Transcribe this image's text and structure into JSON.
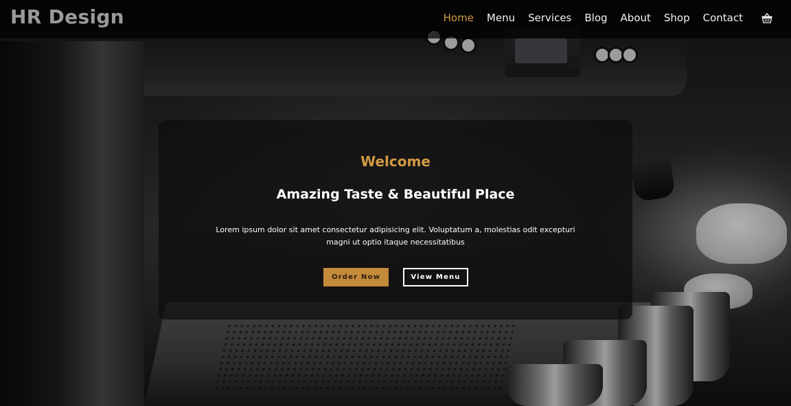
{
  "brand": {
    "name": "HR Design"
  },
  "nav": {
    "items": [
      {
        "label": "Home",
        "active": true
      },
      {
        "label": "Menu",
        "active": false
      },
      {
        "label": "Services",
        "active": false
      },
      {
        "label": "Blog",
        "active": false
      },
      {
        "label": "About",
        "active": false
      },
      {
        "label": "Shop",
        "active": false
      },
      {
        "label": "Contact",
        "active": false
      }
    ],
    "cart_icon": "shopping-basket-icon"
  },
  "hero": {
    "eyebrow": "Welcome",
    "headline": "Amazing Taste & Beautiful Place",
    "description": "Lorem ipsum dolor sit amet consectetur adipisicing elit. Voluptatum a, molestias odit excepturi magni ut optio itaque necessitatibus",
    "buttons": {
      "order_label": "Order Now",
      "view_menu_label": "View Menu"
    }
  },
  "colors": {
    "accent": "#d19a45",
    "button_fill": "#c48b3c",
    "navbar_bg": "#000000",
    "text": "#ffffff"
  }
}
